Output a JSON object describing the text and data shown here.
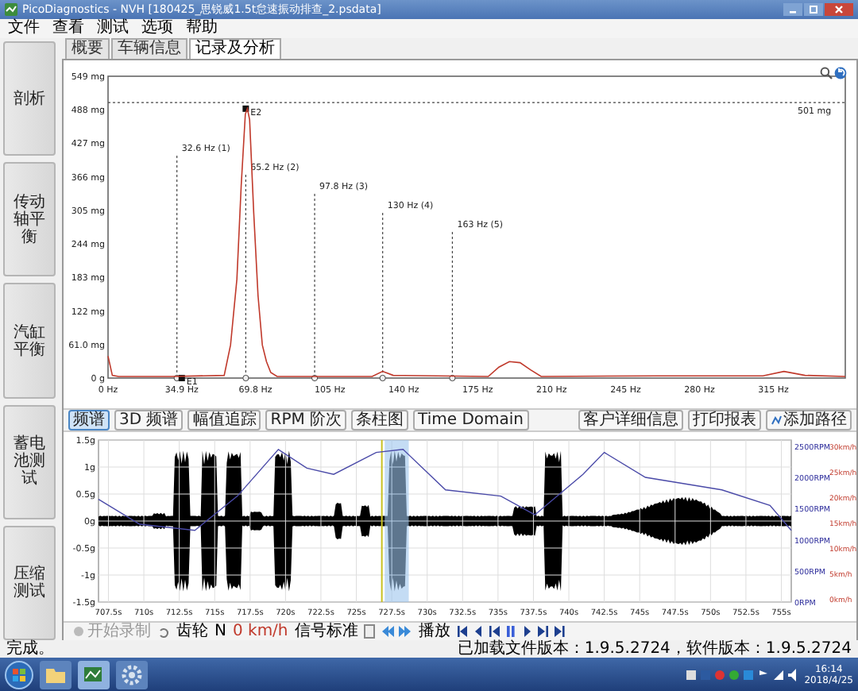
{
  "window": {
    "title": "PicoDiagnostics - NVH [180425_思锐威1.5t怠速振动排查_2.psdata]"
  },
  "menu": [
    "文件",
    "查看",
    "测试",
    "选项",
    "帮助"
  ],
  "sidebar": {
    "items": [
      {
        "label": "剖析"
      },
      {
        "label": "传动轴平衡"
      },
      {
        "label": "汽缸平衡"
      },
      {
        "label": "蓄电池测试"
      },
      {
        "label": "压缩测试"
      }
    ]
  },
  "tabs": [
    {
      "label": "概要",
      "selected": false
    },
    {
      "label": "车辆信息",
      "selected": false
    },
    {
      "label": "记录及分析",
      "selected": true
    }
  ],
  "spectrum": {
    "chart_data": {
      "type": "line",
      "xlim": [
        0,
        349
      ],
      "ylim": [
        0,
        549
      ],
      "x": [
        0,
        2,
        5,
        30,
        55,
        58,
        61,
        63,
        65,
        66,
        67,
        69,
        71,
        73,
        75,
        77,
        80,
        125,
        130,
        135,
        180,
        185,
        190,
        195,
        200,
        205,
        260,
        310,
        320,
        330,
        349
      ],
      "series": [
        {
          "color": "#c0392b",
          "values": [
            40,
            5,
            3,
            3,
            5,
            60,
            180,
            350,
            480,
            490,
            470,
            300,
            150,
            60,
            30,
            10,
            3,
            3,
            12,
            5,
            3,
            20,
            30,
            28,
            15,
            3,
            4,
            4,
            12,
            5,
            3
          ]
        }
      ],
      "xticks": [
        {
          "value": 0,
          "label": "0 Hz"
        },
        {
          "value": 34.9,
          "label": "34.9 Hz"
        },
        {
          "value": 69.8,
          "label": "69.8 Hz"
        },
        {
          "value": 105,
          "label": "105 Hz"
        },
        {
          "value": 140,
          "label": "140 Hz"
        },
        {
          "value": 175,
          "label": "175 Hz"
        },
        {
          "value": 210,
          "label": "210 Hz"
        },
        {
          "value": 245,
          "label": "245 Hz"
        },
        {
          "value": 280,
          "label": "280 Hz"
        },
        {
          "value": 315,
          "label": "315 Hz"
        }
      ],
      "yticks": [
        {
          "value": 0,
          "label": "0 g"
        },
        {
          "value": 61,
          "label": "61.0 mg"
        },
        {
          "value": 122,
          "label": "122 mg"
        },
        {
          "value": 183,
          "label": "183 mg"
        },
        {
          "value": 244,
          "label": "244 mg"
        },
        {
          "value": 305,
          "label": "305 mg"
        },
        {
          "value": 366,
          "label": "366 mg"
        },
        {
          "value": 427,
          "label": "427 mg"
        },
        {
          "value": 488,
          "label": "488 mg"
        },
        {
          "value": 549,
          "label": "549 mg"
        }
      ],
      "ref_lines": [
        {
          "axis": "x",
          "value": 32.6,
          "label": "32.6 Hz (1)"
        },
        {
          "axis": "x",
          "value": 65.2,
          "label": "65.2 Hz (2)"
        },
        {
          "axis": "x",
          "value": 97.8,
          "label": "97.8 Hz (3)"
        },
        {
          "axis": "x",
          "value": 130,
          "label": "130 Hz (4)"
        },
        {
          "axis": "x",
          "value": 163,
          "label": "163 Hz (5)"
        },
        {
          "axis": "y",
          "value": 501,
          "label": "501 mg"
        }
      ],
      "annotations": [
        {
          "text": "E2",
          "x": 65.2,
          "y": 490
        },
        {
          "text": "E1",
          "x": 34.9,
          "y": 0
        }
      ]
    }
  },
  "chart_toolbar": {
    "buttons": [
      {
        "label": "频谱",
        "selected": true
      },
      {
        "label": "3D 频谱",
        "selected": false
      },
      {
        "label": "幅值追踪",
        "selected": false
      },
      {
        "label": "RPM 阶次",
        "selected": false
      },
      {
        "label": "条柱图",
        "selected": false
      },
      {
        "label": "Time Domain",
        "selected": false
      }
    ],
    "actions": [
      {
        "label": "客户详细信息"
      },
      {
        "label": "打印报表"
      },
      {
        "label": "添加路径"
      }
    ]
  },
  "time_chart": {
    "left_axis": [
      "1.5g",
      "1g",
      "0.5g",
      "0g",
      "-0.5g",
      "-1g",
      "-1.5g"
    ],
    "speed_axis": [
      "30km/h",
      "25km/h",
      "20km/h",
      "15km/h",
      "10km/h",
      "5km/h",
      "0km/h"
    ],
    "chart_data": {
      "type": "line",
      "xlim": [
        706.8,
        755.7
      ],
      "ylim": [
        0,
        2600
      ],
      "grid": true,
      "bands": [
        {
          "axis": "x",
          "from": 727,
          "to": 728.7
        }
      ],
      "ref_lines": [
        {
          "axis": "x",
          "value": 726.8
        }
      ],
      "x": [
        706.8,
        709.7,
        713.6,
        716.6,
        719.5,
        721.5,
        723.4,
        726.4,
        728.3,
        731.3,
        735.2,
        737.6,
        741.0,
        742.5,
        745.4,
        750.8,
        754.2,
        755.7
      ],
      "series": [
        {
          "color": "#4a4aa8",
          "values": [
            1650,
            1250,
            1150,
            1700,
            2450,
            2150,
            2050,
            2400,
            2450,
            1800,
            1700,
            1400,
            2050,
            2400,
            2000,
            1800,
            1550,
            1150
          ]
        }
      ],
      "xticks": [
        {
          "value": 707.5,
          "label": "707.5s"
        },
        {
          "value": 710,
          "label": "710s"
        },
        {
          "value": 712.5,
          "label": "712.5s"
        },
        {
          "value": 715,
          "label": "715s"
        },
        {
          "value": 717.5,
          "label": "717.5s"
        },
        {
          "value": 720,
          "label": "720s"
        },
        {
          "value": 722.5,
          "label": "722.5s"
        },
        {
          "value": 725,
          "label": "725s"
        },
        {
          "value": 727.5,
          "label": "727.5s"
        },
        {
          "value": 730,
          "label": "730s"
        },
        {
          "value": 732.5,
          "label": "732.5s"
        },
        {
          "value": 735,
          "label": "735s"
        },
        {
          "value": 737.5,
          "label": "737.5s"
        },
        {
          "value": 740,
          "label": "740s"
        },
        {
          "value": 742.5,
          "label": "742.5s"
        },
        {
          "value": 745,
          "label": "745s"
        },
        {
          "value": 747.5,
          "label": "747.5s"
        },
        {
          "value": 750,
          "label": "750s"
        },
        {
          "value": 752.5,
          "label": "752.5s"
        },
        {
          "value": 755,
          "label": "755s"
        }
      ],
      "yticks": [
        {
          "value": 2500,
          "label": "2500RPM"
        },
        {
          "value": 2000,
          "label": "2000RPM"
        },
        {
          "value": 1500,
          "label": "1500RPM"
        },
        {
          "value": 1000,
          "label": "1000RPM"
        },
        {
          "value": 500,
          "label": "500RPM"
        },
        {
          "value": 0,
          "label": "0RPM"
        }
      ]
    }
  },
  "controls": {
    "record": {
      "label": "开始录制",
      "disabled": true
    },
    "gear": {
      "label": "齿轮",
      "value": "N"
    },
    "speed": "0 km/h",
    "signal": {
      "label": "信号标准"
    },
    "playback": {
      "label": "播放"
    }
  },
  "status_bar": {
    "message": "完成。",
    "versions": "已加载文件版本：1.9.5.2724，软件版本：1.9.5.2724"
  },
  "taskbar": {
    "time": "16:14",
    "date": "2018/4/25"
  }
}
